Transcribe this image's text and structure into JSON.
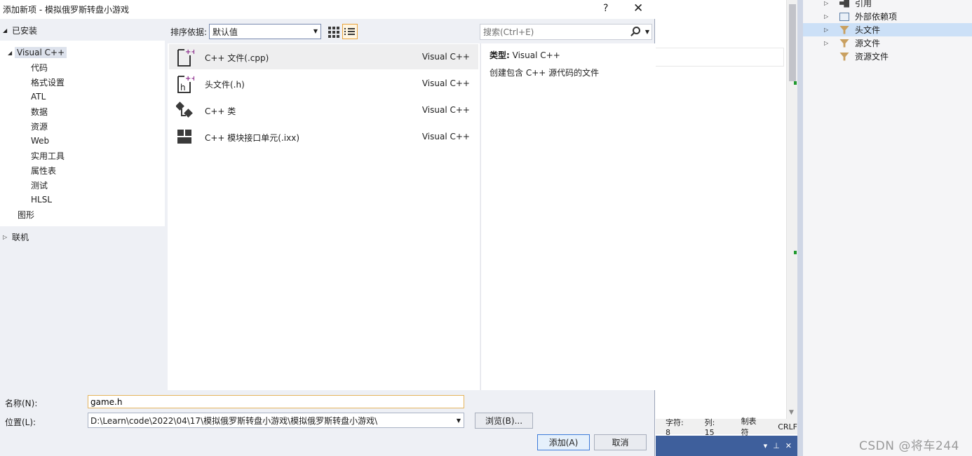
{
  "dialog": {
    "title": "添加新项 - 模拟俄罗斯转盘小游戏",
    "help_label": "?",
    "close_label": "✕",
    "tree": {
      "installed_label": "已安装",
      "nodes": [
        {
          "label": "Visual C++"
        },
        {
          "label": "代码"
        },
        {
          "label": "格式设置"
        },
        {
          "label": "ATL"
        },
        {
          "label": "数据"
        },
        {
          "label": "资源"
        },
        {
          "label": "Web"
        },
        {
          "label": "实用工具"
        },
        {
          "label": "属性表"
        },
        {
          "label": "测试"
        },
        {
          "label": "HLSL"
        },
        {
          "label": "图形"
        }
      ],
      "online_label": "联机"
    },
    "sort": {
      "label": "排序依据:",
      "value": "默认值"
    },
    "search": {
      "placeholder": "搜索(Ctrl+E)"
    },
    "templates": [
      {
        "name": "C++ 文件(.cpp)",
        "category": "Visual C++",
        "icon": "cpp-file-icon"
      },
      {
        "name": "头文件(.h)",
        "category": "Visual C++",
        "icon": "header-file-icon"
      },
      {
        "name": "C++ 类",
        "category": "Visual C++",
        "icon": "cpp-class-icon"
      },
      {
        "name": "C++ 模块接口单元(.ixx)",
        "category": "Visual C++",
        "icon": "module-unit-icon"
      }
    ],
    "details": {
      "type_label": "类型:",
      "type_value": "Visual C++",
      "description": "创建包含 C++ 源代码的文件"
    },
    "form": {
      "name_label": "名称(N):",
      "name_value": "game.h",
      "location_label": "位置(L):",
      "location_value": "D:\\Learn\\code\\2022\\04\\17\\模拟俄罗斯转盘小游戏\\模拟俄罗斯转盘小游戏\\",
      "browse_label": "浏览(B)...",
      "add_label": "添加(A)",
      "cancel_label": "取消"
    }
  },
  "ide": {
    "status": {
      "chars": "字符: 8",
      "col": "列: 15",
      "tabs": "制表符",
      "eol": "CRLF"
    },
    "solution_items": [
      {
        "label": "引用",
        "icon": "references-icon"
      },
      {
        "label": "外部依赖项",
        "icon": "external-deps-icon"
      },
      {
        "label": "头文件",
        "icon": "filter-icon"
      },
      {
        "label": "源文件",
        "icon": "filter-icon"
      },
      {
        "label": "资源文件",
        "icon": "filter-icon"
      }
    ],
    "panel_controls": {
      "dropdown": "▾",
      "pin": "⊥",
      "close": "✕"
    },
    "watermark": "CSDN @将车244"
  },
  "colors": {
    "accent_blue": "#3d7bd9",
    "focus_orange": "#e5b45c",
    "selection": "#cce0f7",
    "cpp_purple": "#8a2a8a"
  }
}
